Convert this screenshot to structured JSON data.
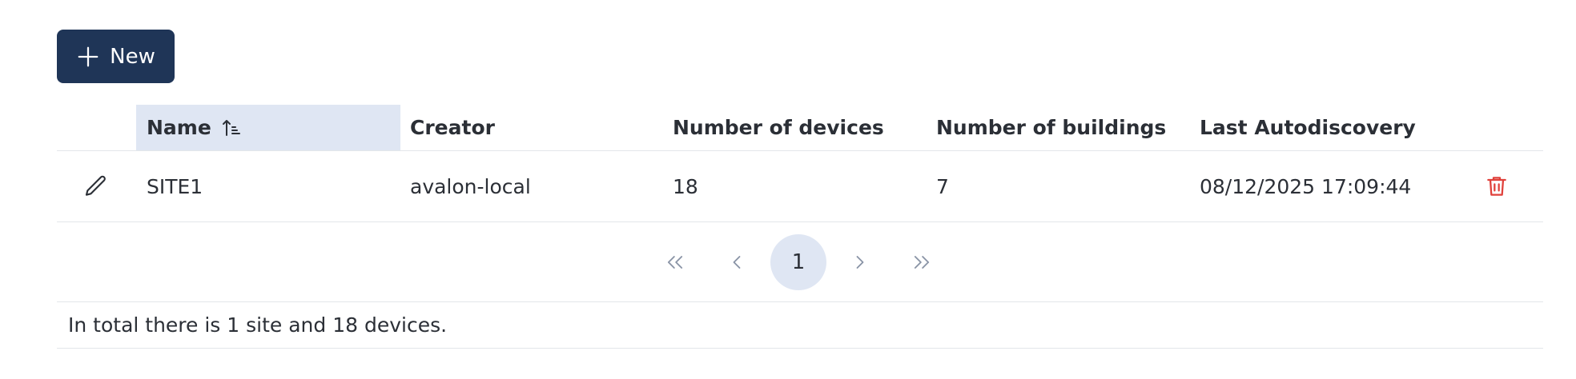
{
  "toolbar": {
    "new_label": "New"
  },
  "table": {
    "columns": [
      "Name",
      "Creator",
      "Number of devices",
      "Number of buildings",
      "Last Autodiscovery"
    ],
    "sorted_column": "Name",
    "rows": [
      {
        "name": "SITE1",
        "creator": "avalon-local",
        "devices": "18",
        "buildings": "7",
        "last_autodiscovery": "08/12/2025 17:09:44"
      }
    ]
  },
  "pagination": {
    "current_page": "1"
  },
  "summary": "In total there is 1 site and 18 devices.",
  "colors": {
    "primary": "#1f3557",
    "sorted_header_bg": "#dfe6f3",
    "delete": "#e0413b"
  }
}
